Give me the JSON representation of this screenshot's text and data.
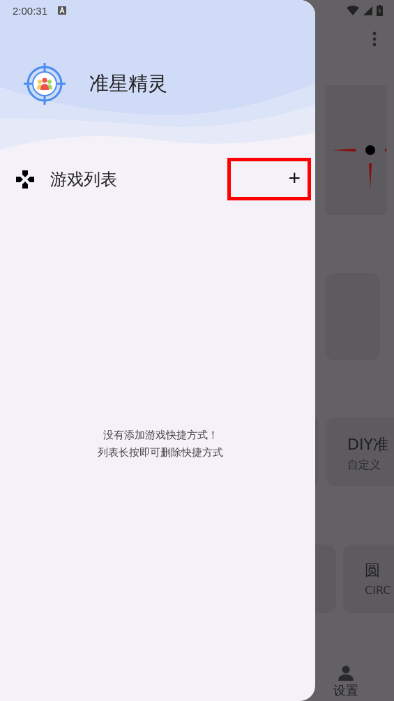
{
  "status_bar": {
    "time": "2:00:31"
  },
  "drawer": {
    "app_title": "准星精灵",
    "section": {
      "label": "游戏列表",
      "add_button": "+"
    },
    "empty_message": [
      "没有添加游戏快捷方式！",
      "列表长按即可删除快捷方式"
    ]
  },
  "background_screen": {
    "cards": [
      {
        "title": "DIY准",
        "subtitle": "自定义"
      },
      {
        "title": "圆",
        "subtitle": "CIRC"
      }
    ],
    "bottom_nav": {
      "label": "设置"
    }
  }
}
